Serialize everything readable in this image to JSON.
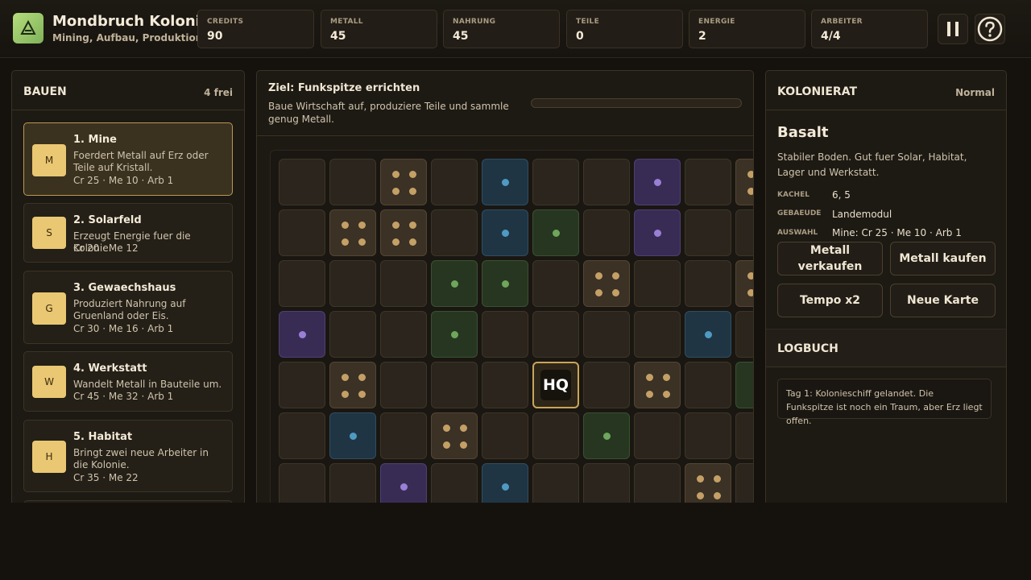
{
  "header": {
    "title": "Mondbruch Kolonie",
    "subtitle": "Mining, Aufbau, Produktion",
    "stats": [
      {
        "label": "CREDITS",
        "value": "90"
      },
      {
        "label": "METALL",
        "value": "45"
      },
      {
        "label": "NAHRUNG",
        "value": "45"
      },
      {
        "label": "TEILE",
        "value": "0"
      },
      {
        "label": "ENERGIE",
        "value": "2"
      },
      {
        "label": "ARBEITER",
        "value": "4/4"
      }
    ],
    "pause_icon": "pause-icon",
    "help_icon": "help-icon"
  },
  "build": {
    "title": "BAUEN",
    "free": "4 frei",
    "items": [
      {
        "badge": "M",
        "title": "1. Mine",
        "desc": "Foerdert Metall auf Erz oder Teile auf Kristall.",
        "cost": "Cr 25 · Me 10 · Arb 1"
      },
      {
        "badge": "S",
        "title": "2. Solarfeld",
        "desc": "Erzeugt Energie fuer die Kolonie.",
        "cost": "Cr 20 · Me 12"
      },
      {
        "badge": "G",
        "title": "3. Gewaechshaus",
        "desc": "Produziert Nahrung auf Gruenland oder Eis.",
        "cost": "Cr 30 · Me 16 · Arb 1"
      },
      {
        "badge": "W",
        "title": "4. Werkstatt",
        "desc": "Wandelt Metall in Bauteile um.",
        "cost": "Cr 45 · Me 32 · Arb 1"
      },
      {
        "badge": "H",
        "title": "5. Habitat",
        "desc": "Bringt zwei neue Arbeiter in die Kolonie.",
        "cost": "Cr 35 · Me 22"
      }
    ]
  },
  "goal": {
    "title": "Ziel: Funkspitze errichten",
    "desc": "Baue Wirtschaft auf, produziere Teile und sammle genug Metall.",
    "progress": 0
  },
  "map": {
    "hq_label": "HQ",
    "rows": [
      [
        "plain",
        "plain",
        "ore",
        "plain",
        "ice",
        "plain",
        "plain",
        "crystal",
        "plain",
        "ore"
      ],
      [
        "plain",
        "ore",
        "ore",
        "plain",
        "ice",
        "green",
        "plain",
        "crystal",
        "plain",
        "plain"
      ],
      [
        "plain",
        "plain",
        "plain",
        "green",
        "green",
        "plain",
        "ore",
        "plain",
        "plain",
        "ore"
      ],
      [
        "crystal",
        "plain",
        "plain",
        "green",
        "plain",
        "plain",
        "plain",
        "plain",
        "ice",
        "plain"
      ],
      [
        "plain",
        "ore",
        "plain",
        "plain",
        "plain",
        "hq",
        "plain",
        "ore",
        "plain",
        "green"
      ],
      [
        "plain",
        "ice",
        "plain",
        "ore",
        "plain",
        "plain",
        "green",
        "plain",
        "plain",
        "plain"
      ],
      [
        "plain",
        "plain",
        "crystal",
        "plain",
        "ice",
        "plain",
        "plain",
        "plain",
        "ore",
        "plain"
      ]
    ]
  },
  "council": {
    "title": "KOLONIERAT",
    "difficulty": "Normal",
    "terrain_name": "Basalt",
    "terrain_desc": "Stabiler Boden. Gut fuer Solar, Habitat, Lager und Werkstatt.",
    "fields": [
      {
        "key": "KACHEL",
        "value": "6, 5"
      },
      {
        "key": "GEBAEUDE",
        "value": "Landemodul"
      },
      {
        "key": "AUSWAHL",
        "value": "Mine: Cr 25 · Me 10 · Arb 1"
      }
    ],
    "actions": [
      "Metall verkaufen",
      "Metall kaufen",
      "Tempo x2",
      "Neue Karte"
    ]
  },
  "logbook": {
    "title": "LOGBUCH",
    "entries": [
      "Tag 1: Kolonieschiff gelandet. Die Funkspitze ist noch ein Traum, aber Erz liegt offen."
    ]
  }
}
